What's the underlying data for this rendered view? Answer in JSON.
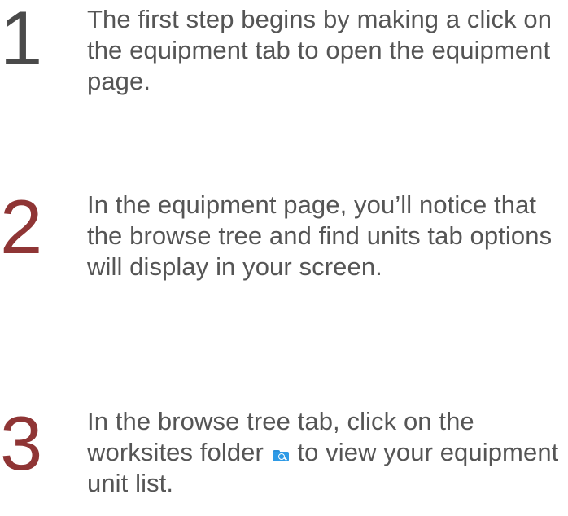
{
  "steps": [
    {
      "number": "1",
      "text": "The first step begins by making a click on the equipment tab to open the equipment page."
    },
    {
      "number": "2",
      "text": "In the equipment page, you’ll notice that the browse tree and find units tab options will display in your screen."
    },
    {
      "number": "3",
      "text_before": "In the browse tree tab, click on the worksites folder",
      "text_after": "to view your equipment unit list.",
      "icon": "worksites-folder-icon"
    }
  ],
  "colors": {
    "step_1_number": "#4a4a4a",
    "step_2_number": "#8f3535",
    "step_3_number": "#8f3535",
    "body_text": "#555555",
    "folder_icon": "#2e9ae6"
  }
}
